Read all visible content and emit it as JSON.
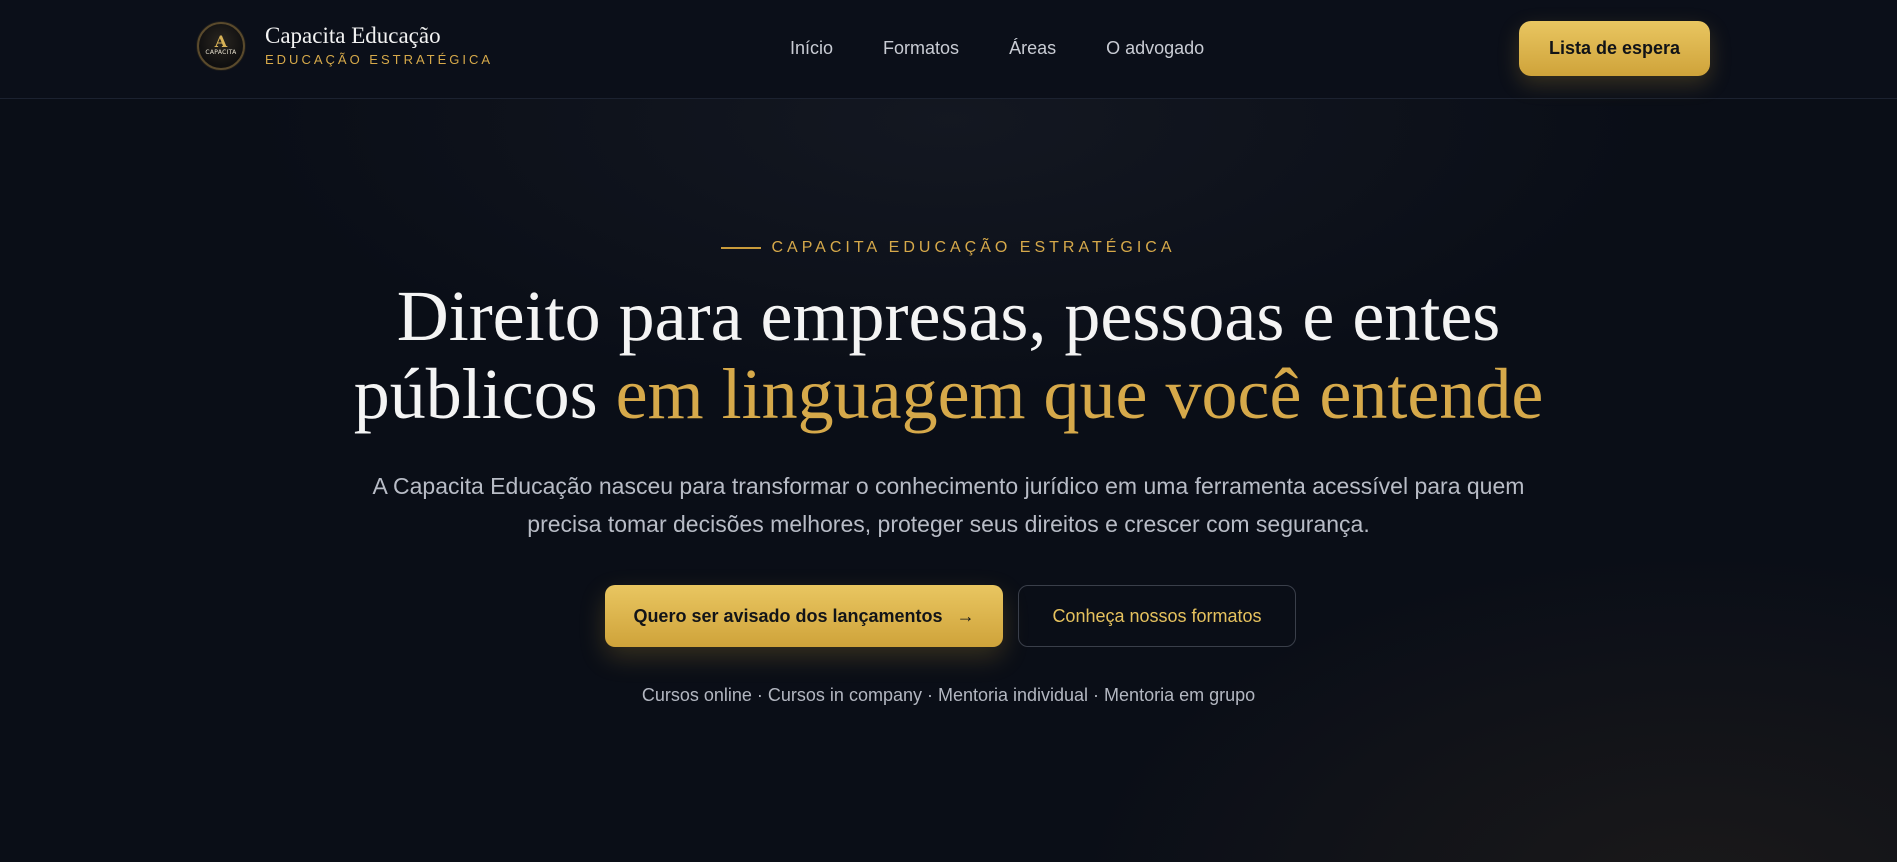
{
  "brand": {
    "name": "Capacita Educação",
    "tagline": "EDUCAÇÃO ESTRATÉGICA",
    "logo_mark": "A",
    "logo_small": "CAPACITA"
  },
  "nav": {
    "items": [
      {
        "label": "Início"
      },
      {
        "label": "Formatos"
      },
      {
        "label": "Áreas"
      },
      {
        "label": "O advogado"
      }
    ],
    "cta_label": "Lista de espera"
  },
  "hero": {
    "eyebrow": "CAPACITA EDUCAÇÃO ESTRATÉGICA",
    "title_line1": "Direito para empresas, pessoas e entes",
    "title_line2_plain": "públicos",
    "title_line2_accent": "em linguagem que você entende",
    "subtitle": "A Capacita Educação nasceu para transformar o conhecimento jurídico em uma ferramenta acessível para quem precisa tomar decisões melhores, proteger seus direitos e crescer com segurança.",
    "primary_button": "Quero ser avisado dos lançamentos",
    "primary_icon": "arrow-right-icon",
    "secondary_button": "Conheça nossos formatos",
    "formats_line": "Cursos online · Cursos in company · Mentoria individual · Mentoria em grupo"
  },
  "colors": {
    "background": "#0a0e17",
    "accent_gold": "#d6a94a",
    "button_gold_top": "#e9c661",
    "button_gold_bottom": "#cfa33a",
    "text_primary": "#f4f4f4",
    "text_muted": "#b8bcc6"
  }
}
